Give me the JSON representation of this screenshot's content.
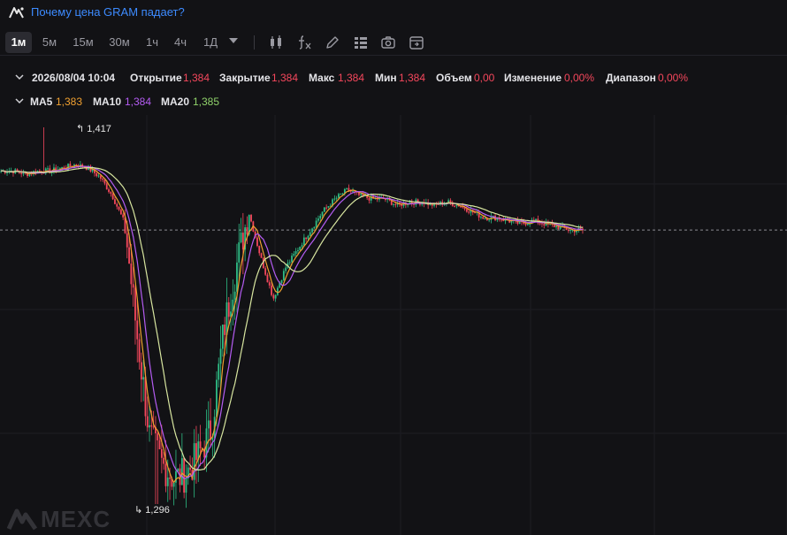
{
  "header": {
    "help_link": "Почему цена GRAM падает?",
    "logo_icon": "mexc-logo-icon"
  },
  "toolbar": {
    "timeframes": [
      "1м",
      "5м",
      "15м",
      "30м",
      "1ч",
      "4ч",
      "1Д"
    ],
    "active_timeframe": "1м",
    "tools": [
      "candlestick-icon",
      "indicator-fx-icon",
      "pencil-icon",
      "layout-list-icon",
      "camera-icon",
      "calendar-icon"
    ]
  },
  "ohlc": {
    "datetime": "2026/08/04 10:04",
    "open_label": "Открытие",
    "open": "1,384",
    "close_label": "Закрытие",
    "close": "1,384",
    "high_label": "Макс",
    "high": "1,384",
    "low_label": "Мин",
    "low": "1,384",
    "volume_label": "Объем",
    "volume": "0,00",
    "change_label": "Изменение",
    "change": "0,00%",
    "range_label": "Диапазон",
    "range": "0,00%"
  },
  "ma": {
    "ma5_label": "MA5",
    "ma5": "1,383",
    "ma10_label": "MA10",
    "ma10": "1,384",
    "ma20_label": "MA20",
    "ma20": "1,385"
  },
  "chart_data": {
    "type": "candlestick",
    "symbol": "GRAM",
    "interval": "1м",
    "high_marker": "1,417",
    "low_marker": "1,296",
    "last_price": 1.384,
    "price_path": [
      1.403,
      1.403,
      1.402,
      1.403,
      1.403,
      1.404,
      1.405,
      1.404,
      1.401,
      1.395,
      1.386,
      1.35,
      1.318,
      1.309,
      1.304,
      1.306,
      1.312,
      1.32,
      1.352,
      1.372,
      1.39,
      1.375,
      1.362,
      1.372,
      1.378,
      1.384,
      1.39,
      1.394,
      1.397,
      1.395,
      1.394,
      1.394,
      1.392,
      1.393,
      1.393,
      1.392,
      1.393,
      1.392,
      1.39,
      1.388,
      1.388,
      1.387,
      1.386,
      1.387,
      1.386,
      1.385,
      1.384,
      1.384
    ],
    "colors": {
      "up": "#2ebd85",
      "down": "#f5475c",
      "ma5": "#f0a030",
      "ma10": "#b45cf2",
      "ma20": "#d8e6a0"
    }
  },
  "watermark": "MEXC"
}
